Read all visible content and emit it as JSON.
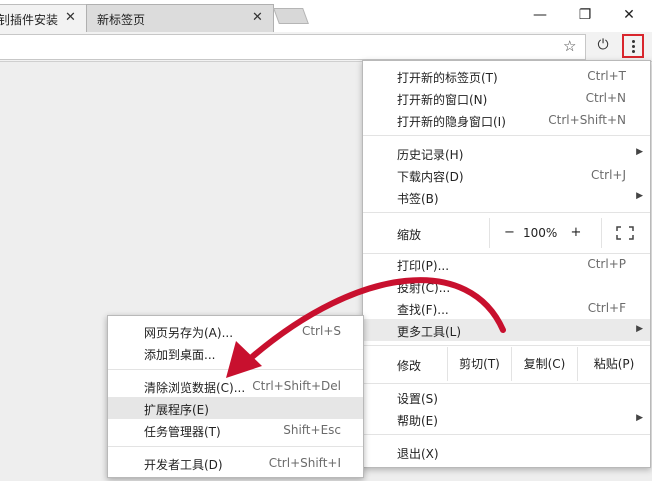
{
  "tabs": [
    {
      "title": "钊插件安装",
      "close": "✕"
    },
    {
      "title": "新标签页",
      "close": "✕"
    }
  ],
  "window_controls": {
    "minimize": "—",
    "restore": "❐",
    "close": "✕"
  },
  "toolbar": {
    "star_icon": "star-icon",
    "star_glyph": "☆",
    "power_glyph": "⏻"
  },
  "main_menu": {
    "new_tab": {
      "label": "打开新的标签页(T)",
      "shortcut": "Ctrl+T"
    },
    "new_window": {
      "label": "打开新的窗口(N)",
      "shortcut": "Ctrl+N"
    },
    "new_incognito": {
      "label": "打开新的隐身窗口(I)",
      "shortcut": "Ctrl+Shift+N"
    },
    "history": {
      "label": "历史记录(H)",
      "arrow": "▶"
    },
    "downloads": {
      "label": "下载内容(D)",
      "shortcut": "Ctrl+J"
    },
    "bookmarks": {
      "label": "书签(B)",
      "arrow": "▶"
    },
    "zoom": {
      "label": "缩放",
      "minus": "−",
      "value": "100%",
      "plus": "+"
    },
    "print": {
      "label": "打印(P)...",
      "shortcut": "Ctrl+P"
    },
    "cast": {
      "label": "投射(C)..."
    },
    "find": {
      "label": "查找(F)...",
      "shortcut": "Ctrl+F"
    },
    "more_tools": {
      "label": "更多工具(L)",
      "arrow": "▶"
    },
    "edit": {
      "label": "修改",
      "cut": "剪切(T)",
      "copy": "复制(C)",
      "paste": "粘贴(P)"
    },
    "settings": {
      "label": "设置(S)"
    },
    "help": {
      "label": "帮助(E)",
      "arrow": "▶"
    },
    "exit": {
      "label": "退出(X)"
    }
  },
  "sub_menu": {
    "save_as": {
      "label": "网页另存为(A)...",
      "shortcut": "Ctrl+S"
    },
    "add_to_desktop": {
      "label": "添加到桌面..."
    },
    "clear_data": {
      "label": "清除浏览数据(C)...",
      "shortcut": "Ctrl+Shift+Del"
    },
    "extensions": {
      "label": "扩展程序(E)"
    },
    "task_manager": {
      "label": "任务管理器(T)",
      "shortcut": "Shift+Esc"
    },
    "dev_tools": {
      "label": "开发者工具(D)",
      "shortcut": "Ctrl+Shift+I"
    }
  },
  "colors": {
    "annotation_arrow": "#c8102e",
    "menu_highlight_border": "#d9262d"
  }
}
